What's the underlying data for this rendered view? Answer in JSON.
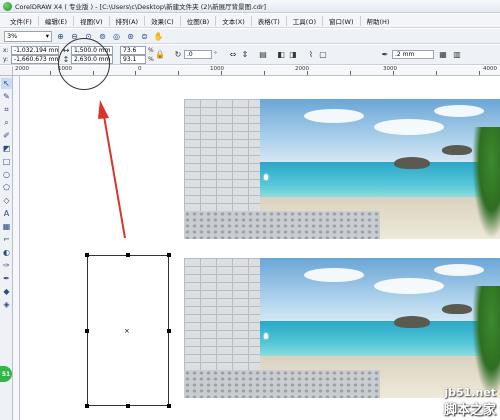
{
  "window": {
    "title": "CorelDRAW X4 ( 专业版 ) - [C:\\Users\\c\\Desktop\\新建文件夹 (2)\\新展厅背景图.cdr]"
  },
  "menu": [
    {
      "label": "文件(F)"
    },
    {
      "label": "编辑(E)"
    },
    {
      "label": "视图(V)"
    },
    {
      "label": "排列(A)"
    },
    {
      "label": "效果(C)"
    },
    {
      "label": "位图(B)"
    },
    {
      "label": "文本(X)"
    },
    {
      "label": "表格(T)"
    },
    {
      "label": "工具(O)"
    },
    {
      "label": "窗口(W)"
    },
    {
      "label": "帮助(H)"
    }
  ],
  "toolbar": {
    "zoom_value": "3%",
    "icons": [
      "zoom-in-icon",
      "zoom-out-icon",
      "zoom-selected-icon",
      "zoom-all-icon",
      "zoom-page-icon",
      "zoom-width-icon",
      "zoom-height-icon",
      "pan-icon"
    ]
  },
  "property_bar": {
    "x_label": "x:",
    "x_value": "-1,032.194 mm",
    "y_label": "y:",
    "y_value": "-1,660.673 mm",
    "width_value": "1,500.0 mm",
    "height_value": "2,630.0 mm",
    "scale_x": "73.6",
    "scale_y": "93.1",
    "percent": "%",
    "rotation": ".0",
    "degree": "°",
    "outline_width": ".2 mm"
  },
  "ruler": {
    "labels": [
      "2000",
      "1000",
      "0",
      "1000",
      "2000",
      "3000",
      "4000",
      "5000"
    ]
  },
  "watermark": {
    "url": "jb51.net",
    "site": "脚本之家"
  },
  "badge": {
    "text": "51"
  },
  "colors": {
    "annotation_arrow": "#d9342b",
    "selection_handles": "#000000",
    "title_bar": "#e3e8f1"
  }
}
